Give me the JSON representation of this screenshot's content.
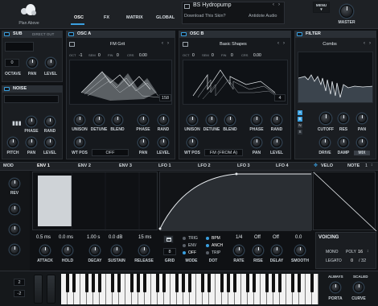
{
  "topbar": {
    "logo_label": "Plan Above",
    "tabs": [
      "OSC",
      "FX",
      "MATRIX",
      "GLOBAL"
    ],
    "preset_name": "BS Hydropump",
    "skin_promo": "Download This Skin?",
    "skin_author": "Antidote Audio",
    "menu_label": "MENU",
    "master_label": "MASTER"
  },
  "sub": {
    "title": "SUB",
    "direct_out": "DIRECT OUT",
    "octave_value": "0",
    "knobs": [
      "OCTAVE",
      "PAN",
      "LEVEL"
    ]
  },
  "noise": {
    "title": "NOISE",
    "knobs_top": [
      "PHASE",
      "RAND"
    ],
    "knobs_bottom": [
      "PITCH",
      "PAN",
      "LEVEL"
    ]
  },
  "osc_a": {
    "title": "OSC A",
    "wavetable": "FM Grit",
    "fields": [
      [
        "OCT",
        "-1"
      ],
      [
        "SEM",
        "0"
      ],
      [
        "FIN",
        "0"
      ],
      [
        "CRS",
        "0.00"
      ]
    ],
    "frame": "158",
    "knobs_mid": [
      "UNISON",
      "DETUNE",
      "BLEND",
      "PHASE",
      "RAND"
    ],
    "wtpos_label": "WT POS",
    "mode_value": "OFF",
    "knobs_bottom": [
      "PAN",
      "LEVEL"
    ]
  },
  "osc_b": {
    "title": "OSC B",
    "wavetable": "Basic Shapes",
    "fields": [
      [
        "OCT",
        "0"
      ],
      [
        "SEM",
        "0"
      ],
      [
        "FIN",
        "0"
      ],
      [
        "CRS",
        "0.00"
      ]
    ],
    "frame": "4",
    "knobs_mid": [
      "UNISON",
      "DETUNE",
      "BLEND",
      "PHASE",
      "RAND"
    ],
    "wtpos_label": "WT POS",
    "mode_value": "FM (FROM A)",
    "knobs_bottom": [
      "PAN",
      "LEVEL"
    ]
  },
  "filter": {
    "title": "FILTER",
    "type": "Combs",
    "routing": [
      "A",
      "B",
      "N",
      "S"
    ],
    "knobs_top": [
      "CUTOFF",
      "RES",
      "PAN"
    ],
    "knobs_bottom": [
      "DRIVE",
      "DAMP",
      "MIX"
    ]
  },
  "mod_tabs": [
    "MOD",
    "ENV 1",
    "ENV 2",
    "ENV 3",
    "LFO 1",
    "LFO 2",
    "LFO 3",
    "LFO 4",
    "VELO",
    "NOTE"
  ],
  "mod_count": "1",
  "mod_side": {
    "rev_label": "REV"
  },
  "envelope": {
    "values": [
      "0.5 ms",
      "0.0 ms",
      "1.00 s",
      "0.0 dB",
      "15 ms"
    ],
    "labels": [
      "ATTACK",
      "HOLD",
      "DECAY",
      "SUSTAIN",
      "RELEASE"
    ]
  },
  "lfo": {
    "grid_value": "8",
    "grid_label": "GRID",
    "trig_options": [
      "TRIG",
      "ENV",
      "OFF"
    ],
    "mode_label": "MODE",
    "timing_options": [
      "BPM",
      "ANCH",
      "TRIP"
    ],
    "dot_label": "DOT",
    "values": [
      "1/4",
      "Off",
      "Off",
      "0.0"
    ],
    "labels": [
      "RATE",
      "RISE",
      "DELAY",
      "SMOOTH"
    ]
  },
  "voicing": {
    "title": "VOICING",
    "mono": "MONO",
    "poly": "POLY",
    "poly_value": "16",
    "legato": "LEGATO",
    "legato_value": "0",
    "voices_value": "/ 32"
  },
  "keyboard": {
    "pitch_up": "2",
    "pitch_down": "-2",
    "porta_label": "PORTA",
    "curve_label": "CURVE",
    "always": "ALWAYS",
    "scaled": "SCALED"
  },
  "colors": {
    "accent": "#3aa0e0",
    "background": "#0f1114",
    "panel": "#1a1d21",
    "header": "#2a2f35"
  }
}
